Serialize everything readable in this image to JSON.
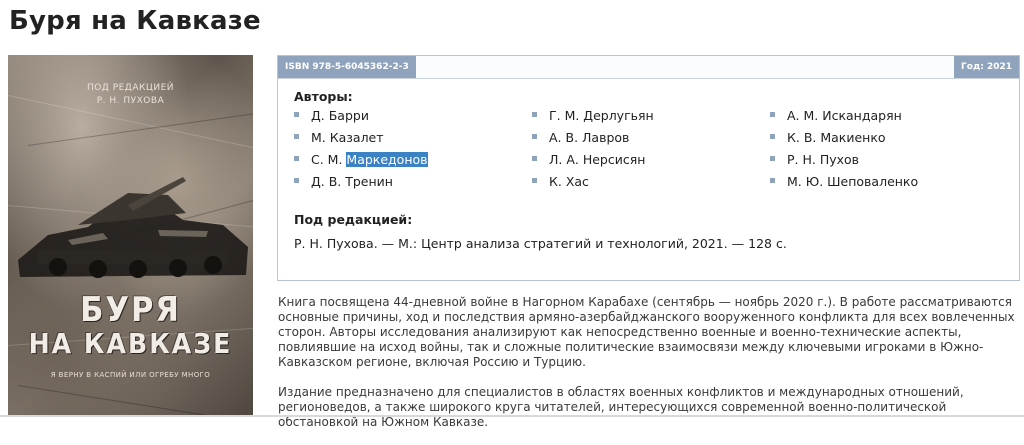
{
  "page": {
    "title": "Буря на Кавказе"
  },
  "cover": {
    "editor_line1": "ПОД РЕДАКЦИЕЙ",
    "editor_line2": "Р. Н. ПУХОВА",
    "title_line1": "БУРЯ",
    "title_line2": "НА КАВКАЗЕ",
    "subtitle": "Я ВЕРНУ В КАСПИЙ ИЛИ ОГРЕБУ МНОГО",
    "colors": {
      "paper": "#8d8276",
      "title": "#f1ede6"
    }
  },
  "info": {
    "isbn": "ISBN 978-5-6045362-2-3",
    "year": "Год: 2021",
    "authors_label": "Авторы:",
    "authors": [
      {
        "name": "Д. Барри",
        "selected": false
      },
      {
        "name": "Г. М. Дерлугьян",
        "selected": false
      },
      {
        "name": "А. М. Искандарян",
        "selected": false
      },
      {
        "name": "М. Казалет",
        "selected": false
      },
      {
        "name": "А. В. Лавров",
        "selected": false
      },
      {
        "name": "К. В. Макиенко",
        "selected": false
      },
      {
        "prefix": "С. М. ",
        "name": "Маркедонов",
        "selected": true
      },
      {
        "name": "Л. А. Нерсисян",
        "selected": false
      },
      {
        "name": "Р. Н. Пухов",
        "selected": false
      },
      {
        "name": "Д. В. Тренин",
        "selected": false
      },
      {
        "name": "К. Хас",
        "selected": false
      },
      {
        "name": "М. Ю. Шеповаленко",
        "selected": false
      }
    ],
    "editors_label": "Под редакцией:",
    "editors_text": "Р. Н. Пухова. — М.: Центр анализа стратегий и технологий, 2021. — 128 с."
  },
  "description": {
    "p1": "Книга посвящена 44-дневной войне в Нагорном Карабахе (сентябрь — ноябрь 2020 г.). В работе рассматриваются основные причины, ход и последствия армяно-азербайджанского вооруженного конфликта для всех вовлеченных сторон. Авторы исследования анализируют как непосредственно военные и военно-технические аспекты, повлиявшие на исход войны, так и сложные политические взаимосвязи между ключевыми игроками в Южно-Кавказском регионе, включая Россию и Турцию.",
    "p2": "Издание предназначено для специалистов в областях военных конфликтов и международных отношений, регионоведов, а также широкого круга читателей, интересующихся современной военно-политической обстановкой на Южном Кавказе."
  },
  "theme": {
    "accent": "#8fa3bd",
    "selection": "#3b82c4",
    "border": "#b8c4d4"
  }
}
